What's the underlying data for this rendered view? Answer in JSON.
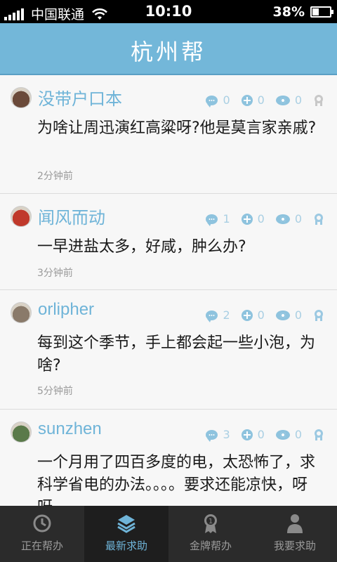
{
  "status_bar": {
    "carrier": "中国联通",
    "time": "10:10",
    "battery": "38%",
    "battery_level": 0.38
  },
  "header": {
    "title": "杭州帮"
  },
  "posts": [
    {
      "username": "没带户口本",
      "comments": "0",
      "adds": "0",
      "views": "0",
      "question": "为啥让周迅演红高粱呀?他是莫言家亲戚?",
      "time": "2分钟前",
      "medal": "gray",
      "avatar_color": "#6b4a3a"
    },
    {
      "username": "闻风而动",
      "comments": "1",
      "adds": "0",
      "views": "0",
      "question": "一早进盐太多，好咸，肿么办?",
      "time": "3分钟前",
      "medal": "blue",
      "avatar_color": "#c0392b"
    },
    {
      "username": "orlipher",
      "comments": "2",
      "adds": "0",
      "views": "0",
      "question": "每到这个季节，手上都会起一些小泡，为啥?",
      "time": "5分钟前",
      "medal": "blue",
      "avatar_color": "#8a7a6a"
    },
    {
      "username": "sunzhen",
      "comments": "3",
      "adds": "0",
      "views": "0",
      "question": "一个月用了四百多度的电，太恐怖了，求科学省电的办法。。。。要求还能凉快，呀呀",
      "time": "",
      "medal": "blue",
      "avatar_color": "#5a7a4a"
    }
  ],
  "bottom_nav": [
    {
      "label": "正在帮办",
      "icon": "clock-icon"
    },
    {
      "label": "最新求助",
      "icon": "layers-icon"
    },
    {
      "label": "金牌帮办",
      "icon": "medal-icon"
    },
    {
      "label": "我要求助",
      "icon": "person-icon"
    }
  ],
  "active_tab": "最新求助",
  "colors": {
    "header": "#73b7d9",
    "accent": "#6fb4d8",
    "nav_bg": "#2b2b2b"
  }
}
